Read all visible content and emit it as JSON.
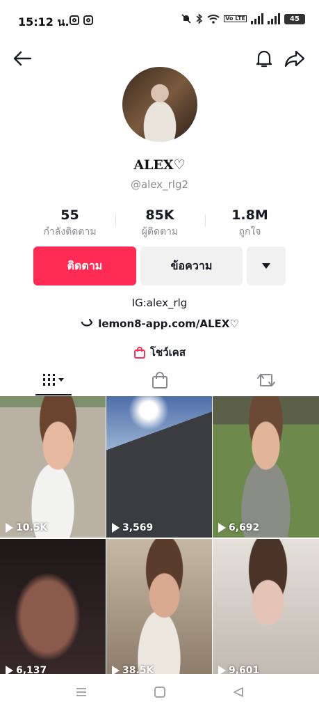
{
  "status_bar": {
    "time": "15:12 น.",
    "volte": "Vo LTE",
    "battery": "45"
  },
  "profile": {
    "display_name": "ALEX♡",
    "username": "@alex_rlg2",
    "stats": [
      {
        "value": "55",
        "label": "กำลังติดตาม"
      },
      {
        "value": "85K",
        "label": "ผู้ติดตาม"
      },
      {
        "value": "1.8M",
        "label": "ถูกใจ"
      }
    ],
    "follow_label": "ติดตาม",
    "message_label": "ข้อความ",
    "bio": "IG:alex_rlg",
    "link": "lemon8-app.com/ALEX♡",
    "showcase_label": "โชว์เคส"
  },
  "tabs": [
    "videos-grid-icon",
    "shopping-bag-icon",
    "repost-icon"
  ],
  "videos": [
    {
      "views": "10.5K"
    },
    {
      "views": "3,569"
    },
    {
      "views": "6,692"
    },
    {
      "views": "6,137"
    },
    {
      "views": "38.5K"
    },
    {
      "views": "9,601"
    }
  ],
  "colors": {
    "accent": "#fe2c55",
    "secondary_button": "#f1f1f2",
    "muted_text": "#8a8b91"
  }
}
